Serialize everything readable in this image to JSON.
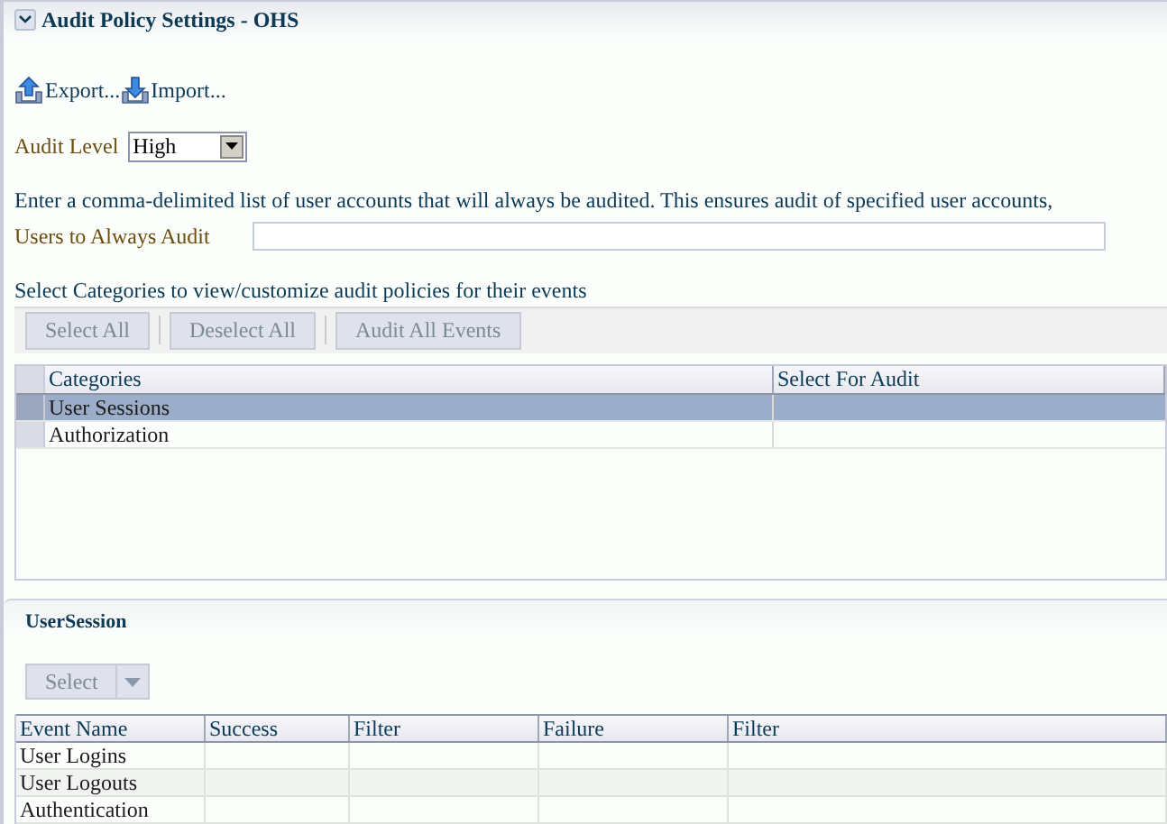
{
  "header": {
    "title": "Audit Policy Settings - OHS",
    "expanded": true
  },
  "actions": [
    {
      "kind": "export",
      "label": "Export..."
    },
    {
      "kind": "import",
      "label": "Import..."
    }
  ],
  "audit_level": {
    "label": "Audit Level",
    "value": "High"
  },
  "users": {
    "description": "Enter a comma-delimited list of user accounts that will always be audited. This ensures audit of specified user accounts,",
    "label": "Users to Always Audit"
  },
  "categories": {
    "caption": "Select Categories to view/customize audit policies for their events",
    "toolbar": [
      {
        "label": "Select All",
        "disabled": true
      },
      {
        "label": "Deselect All",
        "disabled": true
      },
      {
        "label": "Audit All Events",
        "disabled": true
      }
    ],
    "columns": [
      "Categories",
      "Select For Audit"
    ],
    "rows": [
      {
        "name": "User Sessions",
        "selected": true
      },
      {
        "name": "Authorization",
        "selected": false
      }
    ]
  },
  "events": {
    "title": "UserSession",
    "select_button": {
      "label": "Select",
      "disabled": true
    },
    "columns": [
      "Event Name",
      "Success",
      "Filter",
      "Failure",
      "Filter"
    ],
    "rows": [
      {
        "name": "User Logins"
      },
      {
        "name": "User Logouts"
      },
      {
        "name": "Authentication"
      }
    ]
  }
}
